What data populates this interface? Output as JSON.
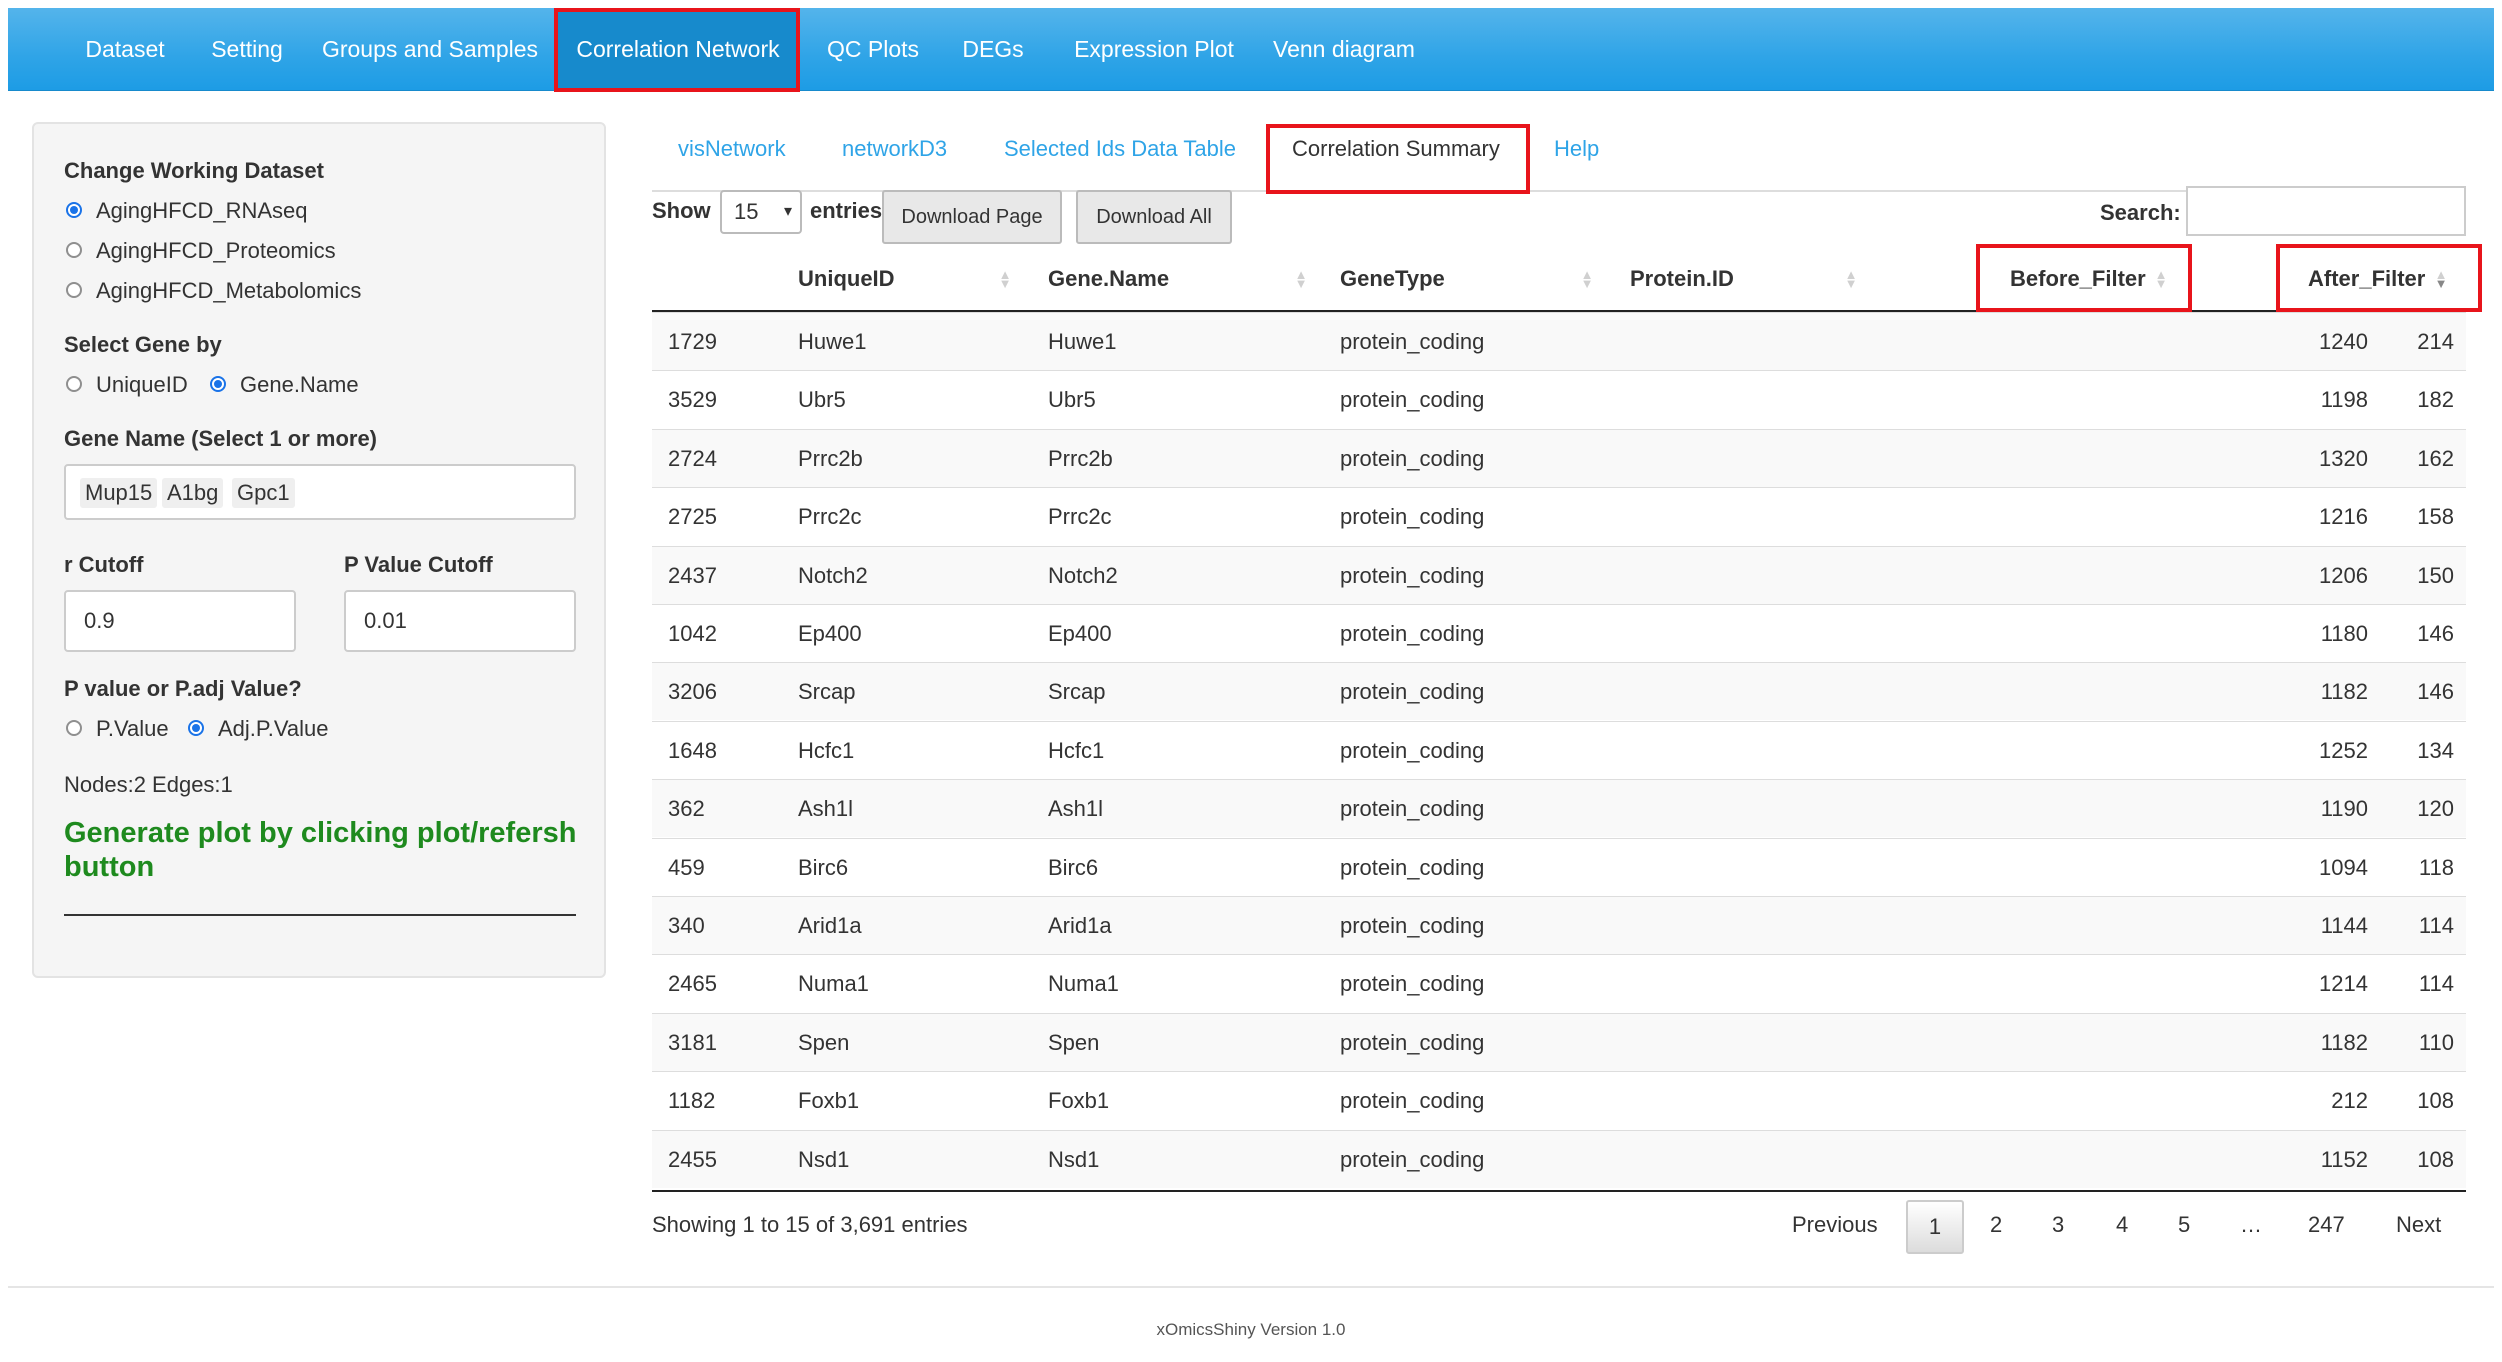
{
  "navbar": {
    "items": [
      "Dataset",
      "Setting",
      "Groups and Samples",
      "Correlation Network",
      "QC Plots",
      "DEGs",
      "Expression Plot",
      "Venn diagram"
    ]
  },
  "sidebar": {
    "dataset_heading": "Change Working Dataset",
    "datasets": [
      "AgingHFCD_RNAseq",
      "AgingHFCD_Proteomics",
      "AgingHFCD_Metabolomics"
    ],
    "selected_dataset": "AgingHFCD_RNAseq",
    "select_gene_heading": "Select Gene by",
    "select_gene_options": [
      "UniqueID",
      "Gene.Name"
    ],
    "selected_gene_by": "Gene.Name",
    "gene_name_heading": "Gene Name (Select 1 or more)",
    "gene_chips": [
      "Mup15",
      "A1bg",
      "Gpc1"
    ],
    "r_cutoff_label": "r Cutoff",
    "r_cutoff_value": "0.9",
    "p_cutoff_label": "P Value Cutoff",
    "p_cutoff_value": "0.01",
    "pvalue_heading": "P value or P.adj Value?",
    "pvalue_options": [
      "P.Value",
      "Adj.P.Value"
    ],
    "selected_pvalue": "Adj.P.Value",
    "nodes_edges": "Nodes:2 Edges:1",
    "message": "Generate plot by clicking plot/refersh button"
  },
  "tabs": [
    "visNetwork",
    "networkD3",
    "Selected Ids Data Table",
    "Correlation Summary",
    "Help"
  ],
  "active_tab": "Correlation Summary",
  "controls": {
    "show_label": "Show",
    "show_value": "15",
    "entries_label": "entries",
    "download_page": "Download Page",
    "download_all": "Download All",
    "search_label": "Search:",
    "search_value": ""
  },
  "table": {
    "columns": [
      "",
      "UniqueID",
      "Gene.Name",
      "GeneType",
      "Protein.ID",
      "Before_Filter",
      "After_Filter"
    ],
    "sorted_column": "After_Filter",
    "sort_direction": "descending",
    "rows": [
      [
        "1729",
        "Huwe1",
        "Huwe1",
        "protein_coding",
        "",
        "1240",
        "214"
      ],
      [
        "3529",
        "Ubr5",
        "Ubr5",
        "protein_coding",
        "",
        "1198",
        "182"
      ],
      [
        "2724",
        "Prrc2b",
        "Prrc2b",
        "protein_coding",
        "",
        "1320",
        "162"
      ],
      [
        "2725",
        "Prrc2c",
        "Prrc2c",
        "protein_coding",
        "",
        "1216",
        "158"
      ],
      [
        "2437",
        "Notch2",
        "Notch2",
        "protein_coding",
        "",
        "1206",
        "150"
      ],
      [
        "1042",
        "Ep400",
        "Ep400",
        "protein_coding",
        "",
        "1180",
        "146"
      ],
      [
        "3206",
        "Srcap",
        "Srcap",
        "protein_coding",
        "",
        "1182",
        "146"
      ],
      [
        "1648",
        "Hcfc1",
        "Hcfc1",
        "protein_coding",
        "",
        "1252",
        "134"
      ],
      [
        "362",
        "Ash1l",
        "Ash1l",
        "protein_coding",
        "",
        "1190",
        "120"
      ],
      [
        "459",
        "Birc6",
        "Birc6",
        "protein_coding",
        "",
        "1094",
        "118"
      ],
      [
        "340",
        "Arid1a",
        "Arid1a",
        "protein_coding",
        "",
        "1144",
        "114"
      ],
      [
        "2465",
        "Numa1",
        "Numa1",
        "protein_coding",
        "",
        "1214",
        "114"
      ],
      [
        "3181",
        "Spen",
        "Spen",
        "protein_coding",
        "",
        "1182",
        "110"
      ],
      [
        "1182",
        "Foxb1",
        "Foxb1",
        "protein_coding",
        "",
        "212",
        "108"
      ],
      [
        "2455",
        "Nsd1",
        "Nsd1",
        "protein_coding",
        "",
        "1152",
        "108"
      ]
    ]
  },
  "info": "Showing 1 to 15 of 3,691 entries",
  "pagination": {
    "previous": "Previous",
    "pages": [
      "1",
      "2",
      "3",
      "4",
      "5",
      "…",
      "247"
    ],
    "current": "1",
    "next": "Next"
  },
  "footer": "xOmicsShiny Version 1.0",
  "colors": {
    "navbar": "#2fa4e7",
    "navbar_active": "#178acc",
    "highlight_box": "#e8141b",
    "link": "#2fa4e7",
    "message_green": "#1e8a1e",
    "radio_checked": "#1a73e8"
  }
}
